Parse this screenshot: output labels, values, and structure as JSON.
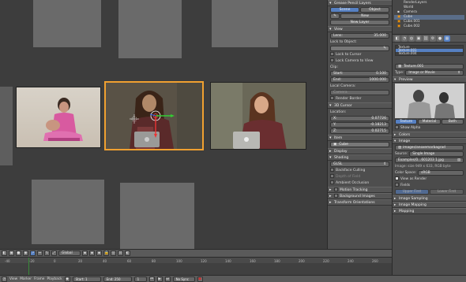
{
  "npanel": {
    "grease_header": "Grease Pencil Layers",
    "scene_btn": "Scene",
    "object_btn": "Object",
    "new_btn": "New",
    "new_layer_btn": "New Layer",
    "view_header": "View",
    "lens_label": "Lens:",
    "lens_value": "35.000",
    "lock_object_label": "Lock to Object:",
    "lock_cursor": "Lock to Cursor",
    "lock_camera": "Lock Camera to View",
    "clip_label": "Clip:",
    "start_label": "Start:",
    "start_value": "0.100",
    "end_label": "End:",
    "end_value": "1000.000",
    "local_camera_label": "Local Camera:",
    "camera_value": "Camera",
    "render_border": "Render Border",
    "cursor_header": "3D Cursor",
    "location_label": "Location:",
    "x_label": "X:",
    "x_value": "0.07726",
    "y_label": "Y:",
    "y_value": "-0.18213",
    "z_label": "Z:",
    "z_value": "0.02715",
    "item_header": "Item",
    "item_name": "Cube",
    "display_header": "Display",
    "shading_header": "Shading",
    "shading_mode": "GLSL",
    "backface": "Backface Culling",
    "depth_of_field": "Depth of Field",
    "ambient_occlusion": "Ambient Occlusion",
    "motion_tracking": "Motion Tracking",
    "background_images": "Background Images",
    "transform_orientations": "Transform Orientations"
  },
  "outliner": {
    "items": [
      "RenderLayers",
      "World",
      "Camera",
      "Cube",
      "Cube.001",
      "Cube.002"
    ]
  },
  "texture": {
    "slots": [
      "Texture",
      "Texture.001",
      "Texture.004"
    ],
    "name": "Texture.001",
    "type_label": "Type:",
    "type_value": "Image or Movie",
    "preview_header": "Preview",
    "tab_texture": "Texture",
    "tab_material": "Material",
    "tab_both": "Both",
    "show_alpha": "Show Alpha",
    "colors_header": "Colors",
    "image_header": "Image",
    "image_path": "images/anoxemarbagrad",
    "source_label": "Source:",
    "source_value": "Single Image",
    "file_name": "Examples/0…601203 1.jpg",
    "image_info": "Image: size 949 x 633, RGB byte",
    "color_space_label": "Color Space:",
    "color_space_value": "sRGB",
    "view_as_render": "View as Render",
    "fields": "Fields",
    "upper_first": "Upper First",
    "lower_first": "Lower First",
    "image_sampling": "Image Sampling",
    "image_mapping": "Image Mapping",
    "mapping": "Mapping"
  },
  "header": {
    "mode": "Global",
    "view": "View",
    "marker": "Marker",
    "frame": "Frame",
    "playback": "Playback",
    "start": "Start: 1",
    "end": "End: 250",
    "current": "1",
    "sync": "No Sync"
  },
  "timeline": {
    "ticks": [
      "-40",
      "-20",
      "0",
      "20",
      "40",
      "60",
      "80",
      "100",
      "120",
      "140",
      "160",
      "180",
      "200",
      "220",
      "240",
      "260"
    ]
  }
}
